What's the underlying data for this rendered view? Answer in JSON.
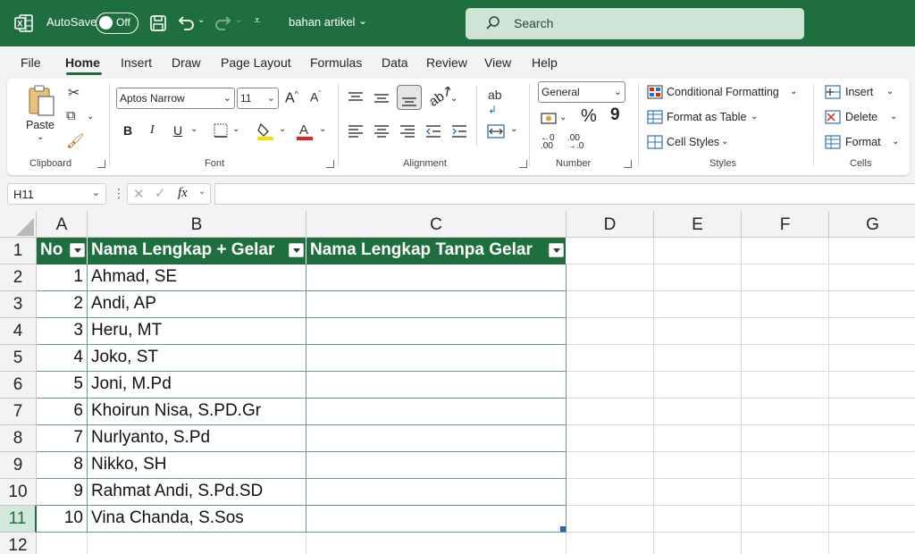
{
  "titlebar": {
    "autosave_label": "AutoSave",
    "autosave_state": "Off",
    "doc_title": "bahan artikel",
    "search_placeholder": "Search"
  },
  "menu": {
    "tabs": [
      "File",
      "Home",
      "Insert",
      "Draw",
      "Page Layout",
      "Formulas",
      "Data",
      "Review",
      "View",
      "Help"
    ],
    "active": "Home"
  },
  "ribbon": {
    "clipboard": {
      "paste": "Paste",
      "label": "Clipboard"
    },
    "font": {
      "name": "Aptos Narrow",
      "size": "11",
      "label": "Font",
      "bold": "B",
      "italic": "I",
      "underline": "U",
      "grow": "A^",
      "shrink": "Aˇ"
    },
    "alignment": {
      "label": "Alignment"
    },
    "number": {
      "format": "General",
      "label": "Number",
      "percent": "%",
      "comma": "9"
    },
    "styles": {
      "conditional": "Conditional Formatting",
      "format_table": "Format as Table",
      "cell_styles": "Cell Styles",
      "label": "Styles"
    },
    "cells": {
      "insert": "Insert",
      "delete": "Delete",
      "format": "Format",
      "label": "Cells"
    }
  },
  "formula_bar": {
    "name_box": "H11",
    "fx": "fx",
    "value": ""
  },
  "grid": {
    "columns": [
      "A",
      "B",
      "C",
      "D",
      "E",
      "F",
      "G"
    ],
    "rows": [
      "1",
      "2",
      "3",
      "4",
      "5",
      "6",
      "7",
      "8",
      "9",
      "10",
      "11",
      "12"
    ],
    "selected_row": "11",
    "table_headers": [
      "No",
      "Nama Lengkap + Gelar",
      "Nama Lengkap Tanpa Gelar"
    ],
    "table_rows": [
      [
        "1",
        "Ahmad, SE",
        ""
      ],
      [
        "2",
        "Andi, AP",
        ""
      ],
      [
        "3",
        "Heru, MT",
        ""
      ],
      [
        "4",
        "Joko, ST",
        ""
      ],
      [
        "5",
        "Joni, M.Pd",
        ""
      ],
      [
        "6",
        "Khoirun Nisa, S.PD.Gr",
        ""
      ],
      [
        "7",
        "Nurlyanto, S.Pd",
        ""
      ],
      [
        "8",
        "Nikko, SH",
        ""
      ],
      [
        "9",
        "Rahmat Andi, S.Pd.SD",
        ""
      ],
      [
        "10",
        "Vina Chanda, S.Sos",
        ""
      ]
    ]
  },
  "colors": {
    "accent": "#1e6e3f",
    "search_bg": "#cfe4d6",
    "ribbon_bg": "#f3f3f3"
  }
}
